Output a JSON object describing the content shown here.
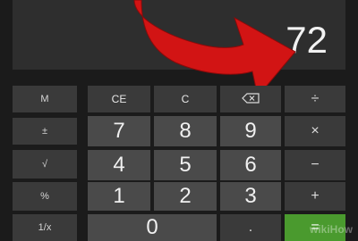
{
  "display": {
    "value": "72"
  },
  "memory_column": [
    "M",
    "±",
    "√",
    "%",
    "1/x"
  ],
  "keys": {
    "ce": "CE",
    "c": "C",
    "backspace_icon": "backspace-icon",
    "divide": "÷",
    "multiply": "×",
    "minus": "−",
    "plus": "+",
    "equals": "=",
    "dot": ".",
    "n7": "7",
    "n8": "8",
    "n9": "9",
    "n4": "4",
    "n5": "5",
    "n6": "6",
    "n1": "1",
    "n2": "2",
    "n3": "3",
    "n0": "0"
  },
  "colors": {
    "accent": "#4a9a2e",
    "arrow": "#d21414",
    "background": "#1b1b1b"
  },
  "watermark": "wikiHow"
}
